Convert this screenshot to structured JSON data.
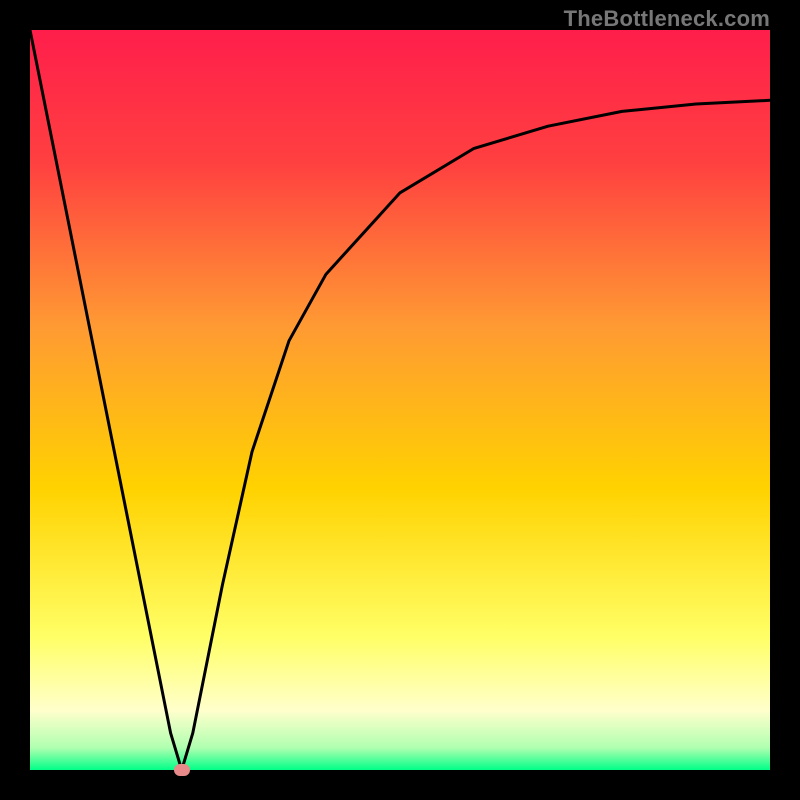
{
  "watermark": "TheBottleneck.com",
  "chart_data": {
    "type": "line",
    "title": "",
    "xlabel": "",
    "ylabel": "",
    "xlim": [
      0,
      100
    ],
    "ylim": [
      0,
      100
    ],
    "background": {
      "gradient_type": "smooth-rainbow-vertical",
      "stops": [
        {
          "pos": 0.0,
          "color": "#ff1e4b"
        },
        {
          "pos": 0.18,
          "color": "#ff4040"
        },
        {
          "pos": 0.4,
          "color": "#ff9a33"
        },
        {
          "pos": 0.62,
          "color": "#ffd200"
        },
        {
          "pos": 0.82,
          "color": "#ffff66"
        },
        {
          "pos": 0.92,
          "color": "#ffffcc"
        },
        {
          "pos": 0.97,
          "color": "#b0ffb0"
        },
        {
          "pos": 1.0,
          "color": "#00ff88"
        }
      ]
    },
    "series": [
      {
        "name": "bottleneck-curve",
        "x": [
          0,
          4,
          8,
          12,
          16,
          19,
          20.5,
          22,
          26,
          30,
          35,
          40,
          50,
          60,
          70,
          80,
          90,
          100
        ],
        "values": [
          100,
          80,
          60,
          40,
          20,
          5,
          0,
          5,
          25,
          43,
          58,
          67,
          78,
          84,
          87,
          89,
          90,
          90.5
        ]
      }
    ],
    "markers": [
      {
        "name": "optimal-point",
        "x": 20.5,
        "y": 0,
        "color": "#e88a8a"
      }
    ]
  }
}
